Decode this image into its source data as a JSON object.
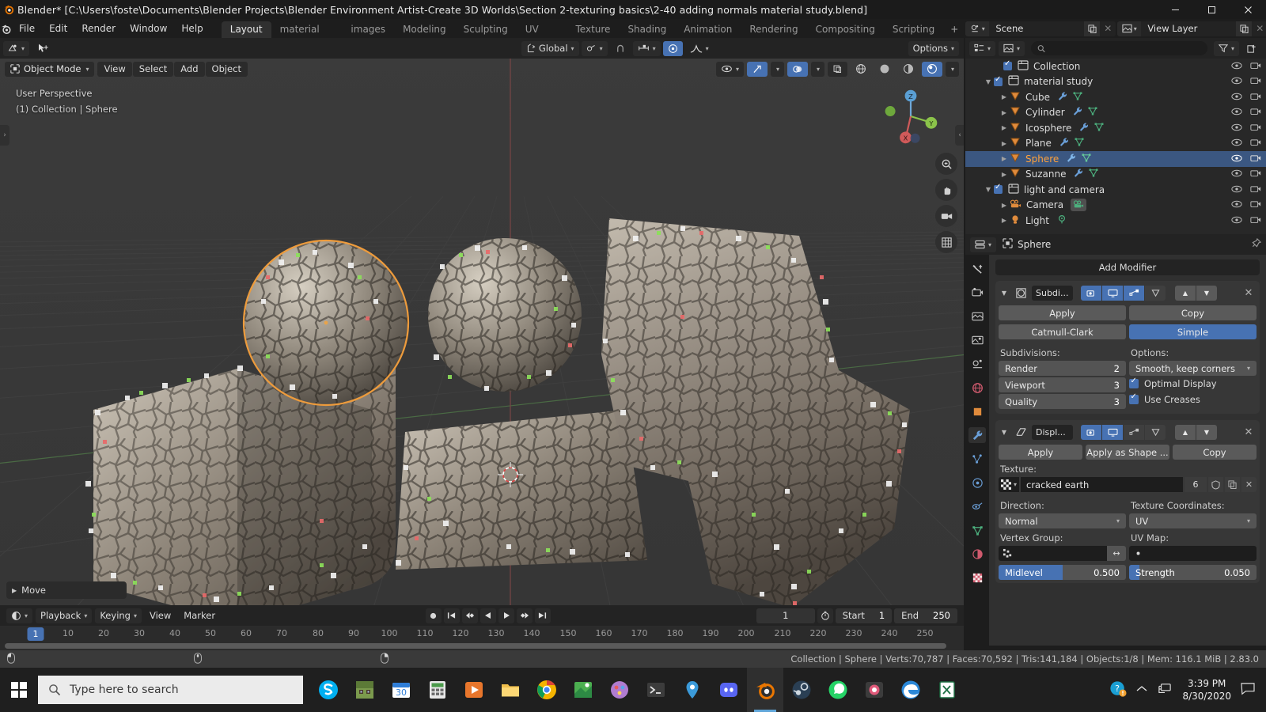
{
  "window": {
    "title": "Blender* [C:\\Users\\foste\\Documents\\Blender Projects\\Blender Environment Artist-Create 3D Worlds\\Section 2-texturing basics\\2-40 adding normals material study.blend]",
    "minimize": "—",
    "maximize": "▢",
    "close": "✕"
  },
  "topbar": {
    "menus": [
      "File",
      "Edit",
      "Render",
      "Window",
      "Help"
    ],
    "tabs": [
      {
        "label": "Layout",
        "active": true
      },
      {
        "label": "material playground",
        "active": false
      },
      {
        "label": "images",
        "active": false
      },
      {
        "label": "Modeling",
        "active": false
      },
      {
        "label": "Sculpting",
        "active": false
      },
      {
        "label": "UV Editing",
        "active": false
      },
      {
        "label": "Texture Paint",
        "active": false
      },
      {
        "label": "Shading",
        "active": false
      },
      {
        "label": "Animation",
        "active": false
      },
      {
        "label": "Rendering",
        "active": false
      },
      {
        "label": "Compositing",
        "active": false
      },
      {
        "label": "Scripting",
        "active": false
      }
    ],
    "add_workspace": "+",
    "scene_name": "Scene",
    "view_layer_name": "View Layer"
  },
  "viewport": {
    "mode": "Object Mode",
    "menus": [
      "View",
      "Select",
      "Add",
      "Object"
    ],
    "transform_orientation": "Global",
    "options_label": "Options",
    "overlay_text_line1": "User Perspective",
    "overlay_text_line2": "(1) Collection | Sphere",
    "operator_panel": "Move",
    "gizmo_axes": [
      "X",
      "Y",
      "Z"
    ]
  },
  "timeline": {
    "menus": [
      "Playback",
      "Keying",
      "View",
      "Marker"
    ],
    "current_frame": "1",
    "start_label": "Start",
    "start_value": "1",
    "end_label": "End",
    "end_value": "250",
    "playhead_frame": "1",
    "ticks": [
      "10",
      "20",
      "30",
      "40",
      "50",
      "60",
      "70",
      "80",
      "90",
      "100",
      "110",
      "120",
      "130",
      "140",
      "150",
      "160",
      "170",
      "180",
      "190",
      "200",
      "210",
      "220",
      "230",
      "240",
      "250"
    ]
  },
  "outliner": {
    "search_placeholder": "",
    "rows": [
      {
        "label": "Collection",
        "indent": 0,
        "type": "collection",
        "checkbox": true,
        "disclosure": "",
        "selected": false,
        "icons": []
      },
      {
        "label": "material study",
        "indent": 1,
        "type": "collection",
        "checkbox": true,
        "disclosure": "▼",
        "selected": false,
        "icons": []
      },
      {
        "label": "Cube",
        "indent": 2,
        "type": "mesh",
        "checkbox": false,
        "disclosure": "▶",
        "selected": false,
        "icons": [
          "wrench",
          "mesh-data"
        ]
      },
      {
        "label": "Cylinder",
        "indent": 2,
        "type": "mesh",
        "checkbox": false,
        "disclosure": "▶",
        "selected": false,
        "icons": [
          "wrench",
          "mesh-data"
        ]
      },
      {
        "label": "Icosphere",
        "indent": 2,
        "type": "mesh",
        "checkbox": false,
        "disclosure": "▶",
        "selected": false,
        "icons": [
          "wrench",
          "mesh-data"
        ]
      },
      {
        "label": "Plane",
        "indent": 2,
        "type": "mesh",
        "checkbox": false,
        "disclosure": "▶",
        "selected": false,
        "icons": [
          "wrench",
          "mesh-data"
        ]
      },
      {
        "label": "Sphere",
        "indent": 2,
        "type": "mesh",
        "checkbox": false,
        "disclosure": "▶",
        "selected": true,
        "icons": [
          "wrench",
          "mesh-data"
        ]
      },
      {
        "label": "Suzanne",
        "indent": 2,
        "type": "mesh",
        "checkbox": false,
        "disclosure": "▶",
        "selected": false,
        "icons": [
          "wrench",
          "mesh-data"
        ]
      },
      {
        "label": "light and camera",
        "indent": 1,
        "type": "collection",
        "checkbox": true,
        "disclosure": "▼",
        "selected": false,
        "icons": []
      },
      {
        "label": "Camera",
        "indent": 2,
        "type": "camera",
        "checkbox": false,
        "disclosure": "▶",
        "selected": false,
        "icons": [
          "camera-data"
        ]
      },
      {
        "label": "Light",
        "indent": 2,
        "type": "light",
        "checkbox": false,
        "disclosure": "▶",
        "selected": false,
        "icons": [
          "light-data"
        ]
      }
    ]
  },
  "properties": {
    "breadcrumb_object": "Sphere",
    "add_modifier": "Add Modifier",
    "modifiers": [
      {
        "name": "Subdi...",
        "icon": "subsurf-icon",
        "toggles": [
          {
            "name": "render",
            "on": true
          },
          {
            "name": "realtime",
            "on": true
          },
          {
            "name": "edit-mode",
            "on": true
          },
          {
            "name": "on-cage",
            "on": false
          }
        ],
        "buttons": [
          "Apply",
          "Copy"
        ],
        "subdiv_types": [
          {
            "label": "Catmull-Clark",
            "active": false
          },
          {
            "label": "Simple",
            "active": true
          }
        ],
        "subdivisions_label": "Subdivisions:",
        "options_label": "Options:",
        "fields": [
          {
            "label": "Render",
            "value": "2"
          },
          {
            "label": "Viewport",
            "value": "3"
          },
          {
            "label": "Quality",
            "value": "3"
          }
        ],
        "uv_smooth": "Smooth, keep corners",
        "checkboxes": [
          {
            "label": "Optimal Display",
            "checked": true
          },
          {
            "label": "Use Creases",
            "checked": true
          }
        ]
      },
      {
        "name": "Displ...",
        "icon": "displace-icon",
        "toggles": [
          {
            "name": "render",
            "on": true
          },
          {
            "name": "realtime",
            "on": true
          },
          {
            "name": "edit-mode",
            "on": false
          },
          {
            "name": "on-cage",
            "on": false
          }
        ],
        "buttons": [
          "Apply",
          "Apply as Shape ...",
          "Copy"
        ],
        "texture_label": "Texture:",
        "texture_name": "cracked earth",
        "texture_users": "6",
        "direction_label": "Direction:",
        "direction_value": "Normal",
        "texcoords_label": "Texture Coordinates:",
        "texcoords_value": "UV",
        "vertex_group_label": "Vertex Group:",
        "vertex_group_value": "",
        "uv_map_label": "UV Map:",
        "uv_map_value": "",
        "midlevel_label": "Midlevel",
        "midlevel_value": "0.500",
        "midlevel_fill_pct": 50,
        "strength_label": "Strength",
        "strength_value": "0.050",
        "strength_fill_pct": 8
      }
    ]
  },
  "statusbar": {
    "stats": "Collection | Sphere | Verts:70,787 | Faces:70,592 | Tris:141,184 | Objects:1/8 | Mem: 116.1 MiB | 2.83.0"
  },
  "taskbar": {
    "search_placeholder": "Type here to search",
    "time": "3:39 PM",
    "date": "8/30/2020",
    "apps": [
      {
        "name": "skype",
        "color": "#00aff0"
      },
      {
        "name": "minecraft",
        "color": "#7b9a4d"
      },
      {
        "name": "calendar",
        "color": "#2e7dd7"
      },
      {
        "name": "calculator",
        "color": "#4a9a4a"
      },
      {
        "name": "media-player",
        "color": "#e8762c"
      },
      {
        "name": "file-explorer",
        "color": "#f0bf4c"
      },
      {
        "name": "chrome",
        "color": "#dd4b39"
      },
      {
        "name": "maps",
        "color": "#4caf50"
      },
      {
        "name": "paint",
        "color": "#b07cd0"
      },
      {
        "name": "terminal",
        "color": "#9a9a9a"
      },
      {
        "name": "location",
        "color": "#3b9ad9"
      },
      {
        "name": "discord",
        "color": "#5865f2"
      },
      {
        "name": "blender",
        "color": "#ea7600"
      },
      {
        "name": "steam",
        "color": "#3a6e8f"
      },
      {
        "name": "whatsapp",
        "color": "#25d366"
      },
      {
        "name": "photos",
        "color": "#e05a7a"
      },
      {
        "name": "edge",
        "color": "#2b88d8"
      },
      {
        "name": "excel",
        "color": "#1d7044"
      }
    ]
  }
}
